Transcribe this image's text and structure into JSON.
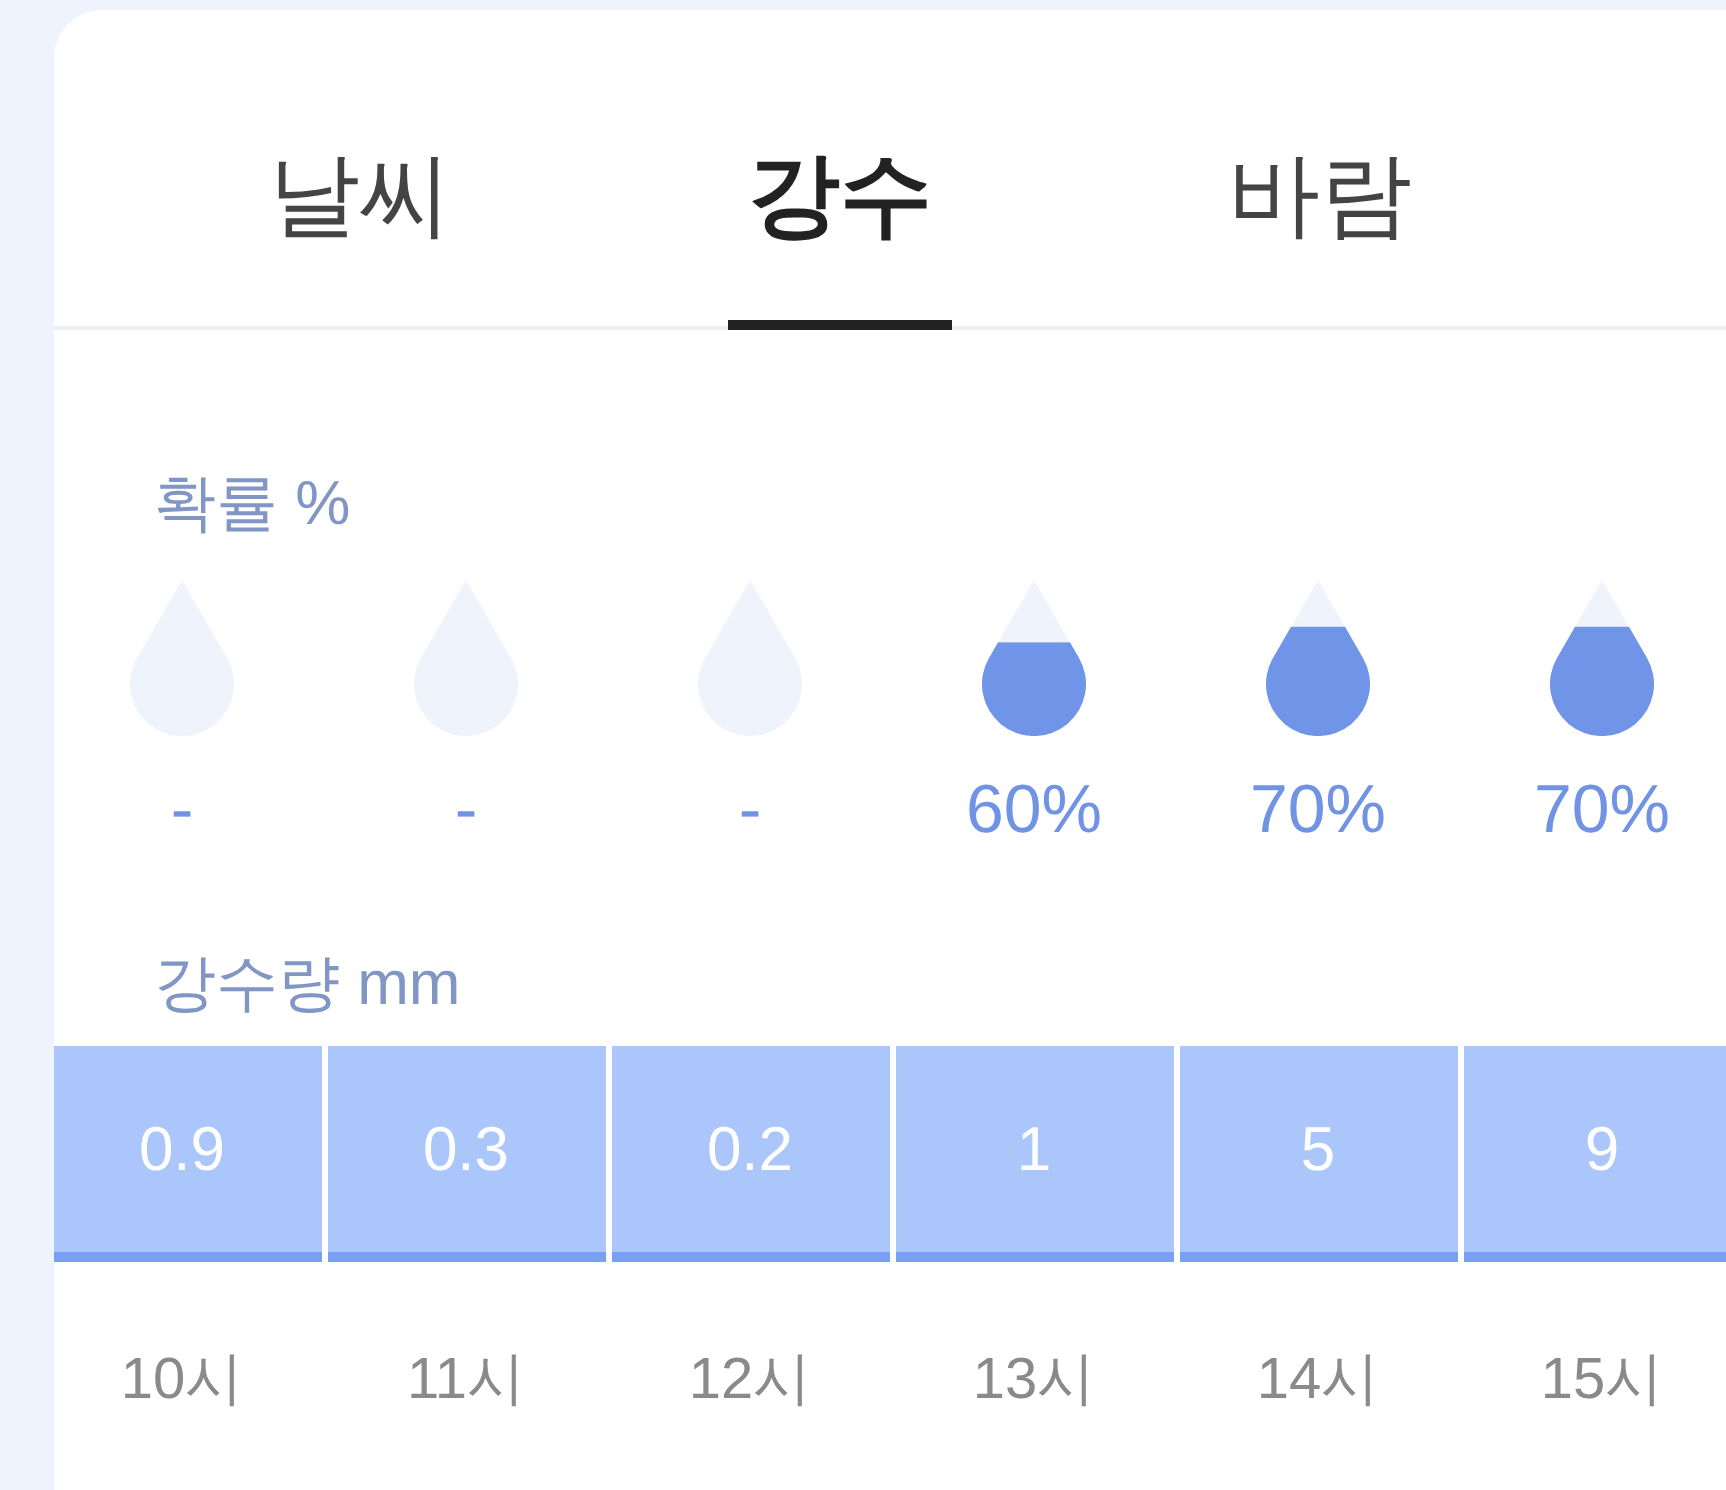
{
  "tabs": [
    {
      "label": "날씨",
      "selected": false
    },
    {
      "label": "강수",
      "selected": true
    },
    {
      "label": "바람",
      "selected": false
    }
  ],
  "probability": {
    "label": "확률 %",
    "hours": [
      {
        "reading": "-"
      },
      {
        "reading": "-"
      },
      {
        "reading": "-"
      },
      {
        "level": 0.6,
        "reading": "60%"
      },
      {
        "level": 0.7,
        "reading": "70%"
      },
      {
        "level": 0.7,
        "reading": "70%"
      }
    ]
  },
  "amount": {
    "label": "강수량 mm",
    "values": [
      "0.9",
      "0.3",
      "0.2",
      "1",
      "5",
      "9"
    ]
  },
  "times": [
    "10시",
    "11시",
    "12시",
    "13시",
    "14시",
    "15시"
  ]
}
